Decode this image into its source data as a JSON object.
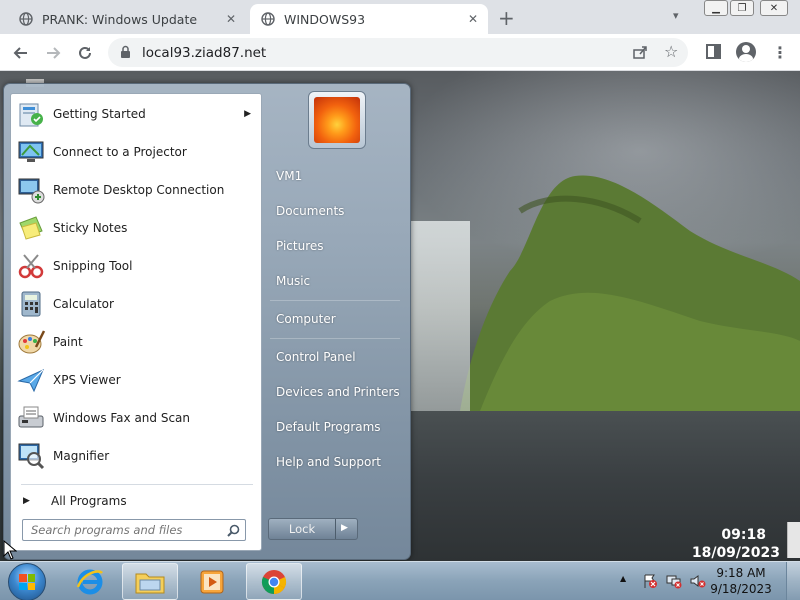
{
  "browser": {
    "tabs": [
      {
        "title": "PRANK: Windows Update",
        "active": false
      },
      {
        "title": "WINDOWS93",
        "active": true
      }
    ],
    "url": "local93.ziad87.net"
  },
  "start_menu": {
    "programs": [
      {
        "label": "Getting Started",
        "icon": "getting-started-icon",
        "has_submenu": true
      },
      {
        "label": "Connect to a Projector",
        "icon": "projector-icon"
      },
      {
        "label": "Remote Desktop Connection",
        "icon": "remote-desktop-icon"
      },
      {
        "label": "Sticky Notes",
        "icon": "sticky-notes-icon"
      },
      {
        "label": "Snipping Tool",
        "icon": "snipping-tool-icon"
      },
      {
        "label": "Calculator",
        "icon": "calculator-icon"
      },
      {
        "label": "Paint",
        "icon": "paint-icon"
      },
      {
        "label": "XPS Viewer",
        "icon": "xps-viewer-icon"
      },
      {
        "label": "Windows Fax and Scan",
        "icon": "fax-scan-icon"
      },
      {
        "label": "Magnifier",
        "icon": "magnifier-icon"
      }
    ],
    "all_programs": "All Programs",
    "search_placeholder": "Search programs and files",
    "right_links": [
      "VM1",
      "Documents",
      "Pictures",
      "Music",
      "Computer",
      "Control Panel",
      "Devices and Printers",
      "Default Programs",
      "Help and Support"
    ],
    "lock_label": "Lock"
  },
  "desktop_clock": {
    "time": "09:18",
    "date": "18/09/2023"
  },
  "taskbar": {
    "pinned": [
      "internet-explorer-icon",
      "windows-explorer-icon",
      "media-player-icon",
      "chrome-icon"
    ],
    "tray_time": "9:18 AM",
    "tray_date": "9/18/2023"
  },
  "colors": {
    "accent": "#1a73e8",
    "taskbar": "#8aa3b8",
    "start_right_pane": "#7f95ab"
  }
}
